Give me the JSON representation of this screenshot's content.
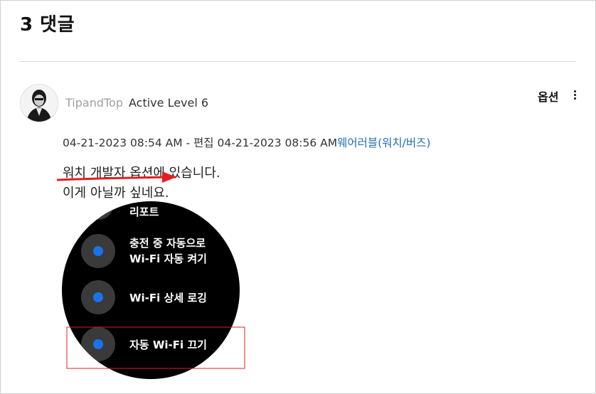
{
  "section": {
    "title": "3 댓글"
  },
  "comment": {
    "username": "TipandTop",
    "rank": "Active Level 6",
    "options_label": "옵션",
    "posted": "04-21-2023 08:54 AM",
    "separator": " - ",
    "edited_label": "편집",
    "edited": "04-21-2023 08:56 AM",
    "board": "웨어러블(워치/버즈)",
    "body_line1": "워치 개발자 옵션에 있습니다.",
    "body_line2": "이게 아닐까 싶네요."
  },
  "screenshot_menu": {
    "items": [
      {
        "label": "리포트"
      },
      {
        "label_line1": "충전 중 자동으로",
        "label_line2": "Wi-Fi 자동 켜기"
      },
      {
        "label": "Wi-Fi 상세 로깅"
      },
      {
        "label": "자동 Wi-Fi 끄기"
      }
    ]
  },
  "colors": {
    "accent_link": "#1f6fb5",
    "toggle_dot": "#1a73e8",
    "annotation_red": "#e02020"
  }
}
